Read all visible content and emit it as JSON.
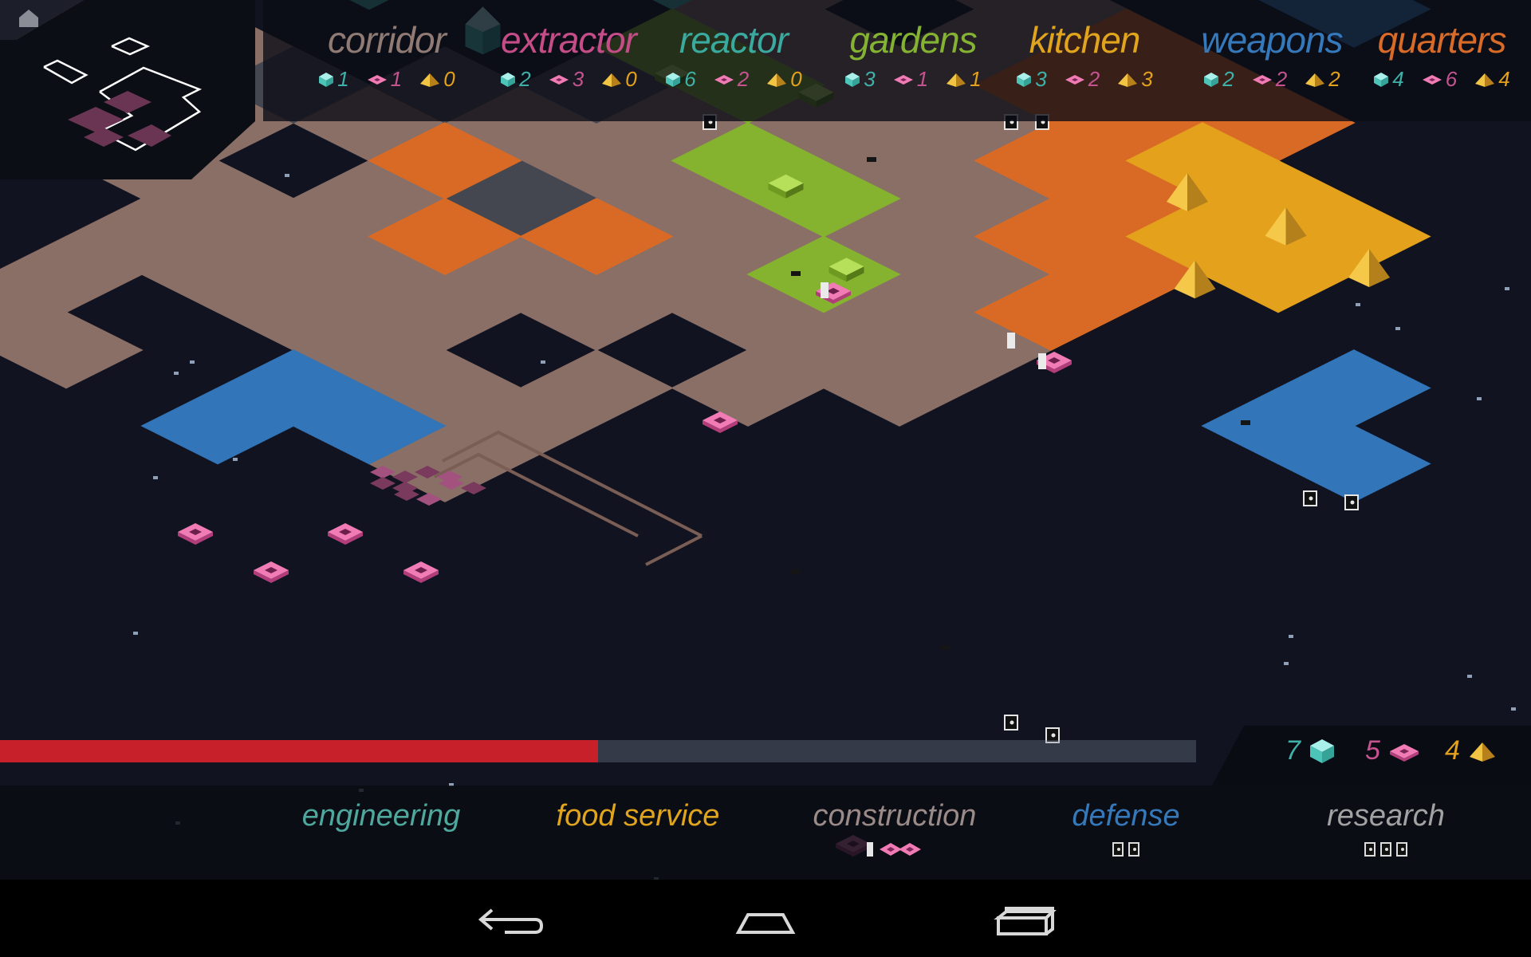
{
  "colors": {
    "corridor": "#8a6f67",
    "extractor": "#c4538f",
    "reactor": "#3fb1a8",
    "gardens": "#86b32f",
    "kitchen": "#e3a11c",
    "weapons": "#3275b8",
    "quarters": "#d96a25",
    "cube": "#5fd6cc",
    "disc": "#e55aa1",
    "pyramid": "#e9b428",
    "corridor_text": "#8f7a74",
    "extractor_text": "#c44d88",
    "reactor_text": "#3aa99e",
    "gardens_text": "#84b232",
    "kitchen_text": "#e0a41d",
    "weapons_text": "#3579bb",
    "quarters_text": "#d86b27",
    "engineering_text": "#4ea89d",
    "food_text": "#e0a41d",
    "construction_text": "#9a8a88",
    "defense_text": "#3579bb",
    "research_text": "#a2a2a2",
    "progress_fill": "#c8202a"
  },
  "rooms": [
    {
      "id": "corridor",
      "label": "corridor",
      "cube": "1",
      "disc": "1",
      "pyramid": "0"
    },
    {
      "id": "extractor",
      "label": "extractor",
      "cube": "2",
      "disc": "3",
      "pyramid": "0"
    },
    {
      "id": "reactor",
      "label": "reactor",
      "cube": "6",
      "disc": "2",
      "pyramid": "0"
    },
    {
      "id": "gardens",
      "label": "gardens",
      "cube": "3",
      "disc": "1",
      "pyramid": "1"
    },
    {
      "id": "kitchen",
      "label": "kitchen",
      "cube": "3",
      "disc": "2",
      "pyramid": "3"
    },
    {
      "id": "weapons",
      "label": "weapons",
      "cube": "2",
      "disc": "2",
      "pyramid": "2"
    },
    {
      "id": "quarters",
      "label": "quarters",
      "cube": "4",
      "disc": "6",
      "pyramid": "4"
    }
  ],
  "resources": {
    "cube": "7",
    "disc": "5",
    "pyramid": "4"
  },
  "progress": 0.5,
  "departments": [
    {
      "id": "engineering",
      "label": "engineering"
    },
    {
      "id": "food",
      "label": "food service"
    },
    {
      "id": "construction",
      "label": "construction"
    },
    {
      "id": "defense",
      "label": "defense"
    },
    {
      "id": "research",
      "label": "research"
    }
  ],
  "icons": {
    "home": "home-icon",
    "back": "back-icon",
    "nav_home": "nav-home-icon",
    "recents": "recents-icon",
    "cube": "cube-icon",
    "disc": "disc-icon",
    "pyramid": "pyramid-icon",
    "worker": "worker-icon",
    "robot": "robot-icon"
  }
}
